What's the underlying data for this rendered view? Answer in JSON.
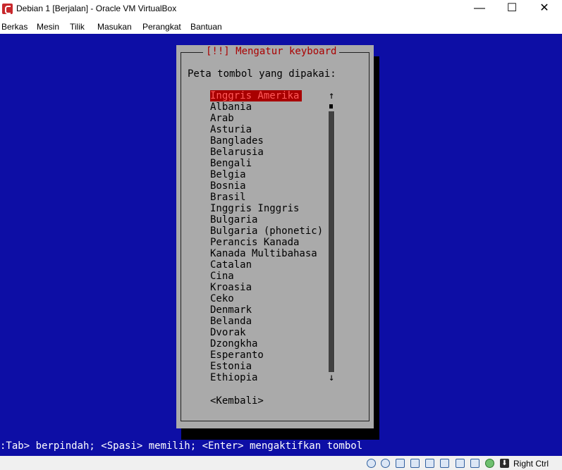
{
  "window": {
    "title": "Debian 1 [Berjalan] - Oracle VM VirtualBox",
    "controls": {
      "minimize": "—",
      "maximize": "☐",
      "close": "✕"
    }
  },
  "menu": [
    "Berkas",
    "Mesin",
    "Tilik",
    "Masukan",
    "Perangkat",
    "Bantuan"
  ],
  "installer": {
    "dialog_title": "[!!] Mengatur keyboard",
    "prompt": "Peta tombol yang dipakai:",
    "layouts": [
      "Inggris Amerika",
      "Albania",
      "Arab",
      "Asturia",
      "Banglades",
      "Belarusia",
      "Bengali",
      "Belgia",
      "Bosnia",
      "Brasil",
      "Inggris Inggris",
      "Bulgaria",
      "Bulgaria (phonetic)",
      "Perancis Kanada",
      "Kanada Multibahasa",
      "Catalan",
      "Cina",
      "Kroasia",
      "Ceko",
      "Denmark",
      "Belanda",
      "Dvorak",
      "Dzongkha",
      "Esperanto",
      "Estonia",
      "Ethiopia"
    ],
    "selected_index": 0,
    "scroll_up": "↑",
    "scroll_down": "↓",
    "back_button": "<Kembali>",
    "help_line": ":Tab> berpindah; <Spasi> memilih; <Enter> mengaktifkan tombol"
  },
  "statusbar": {
    "host_key": "Right Ctrl",
    "icons": [
      "hard-disk-icon",
      "optical-drive-icon",
      "audio-icon",
      "usb-icon",
      "shared-folders-icon",
      "display-icon",
      "network-icon",
      "recording-icon",
      "cpu-icon",
      "mouse-integration-icon",
      "host-key-arrow-icon"
    ]
  },
  "colors": {
    "screen_background": "#0d0ea5",
    "dialog_background": "#aaaaaa",
    "title_color": "#aa0000",
    "selection_background": "#a80000"
  }
}
